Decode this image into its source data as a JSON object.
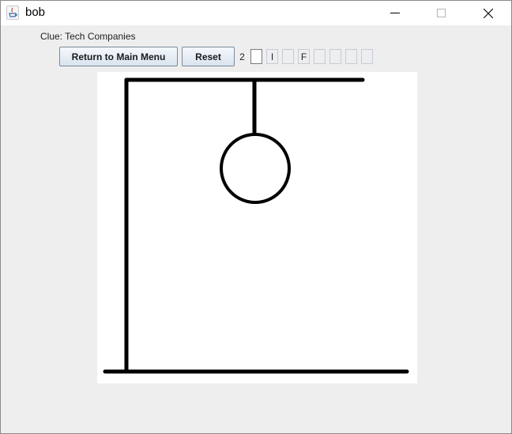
{
  "window": {
    "title": "bob"
  },
  "clue": {
    "text": "Clue: Tech Companies"
  },
  "toolbar": {
    "return_label": "Return to Main Menu",
    "reset_label": "Reset"
  },
  "guesses": {
    "count": "2",
    "letters": [
      "",
      "I",
      "",
      "F",
      "",
      "",
      "",
      ""
    ]
  },
  "hangman": {
    "parts_drawn": [
      "base",
      "pole",
      "beam",
      "rope",
      "head"
    ]
  },
  "colors": {
    "window_bg": "#eeeeee",
    "canvas_bg": "#ffffff",
    "stroke": "#000000"
  }
}
